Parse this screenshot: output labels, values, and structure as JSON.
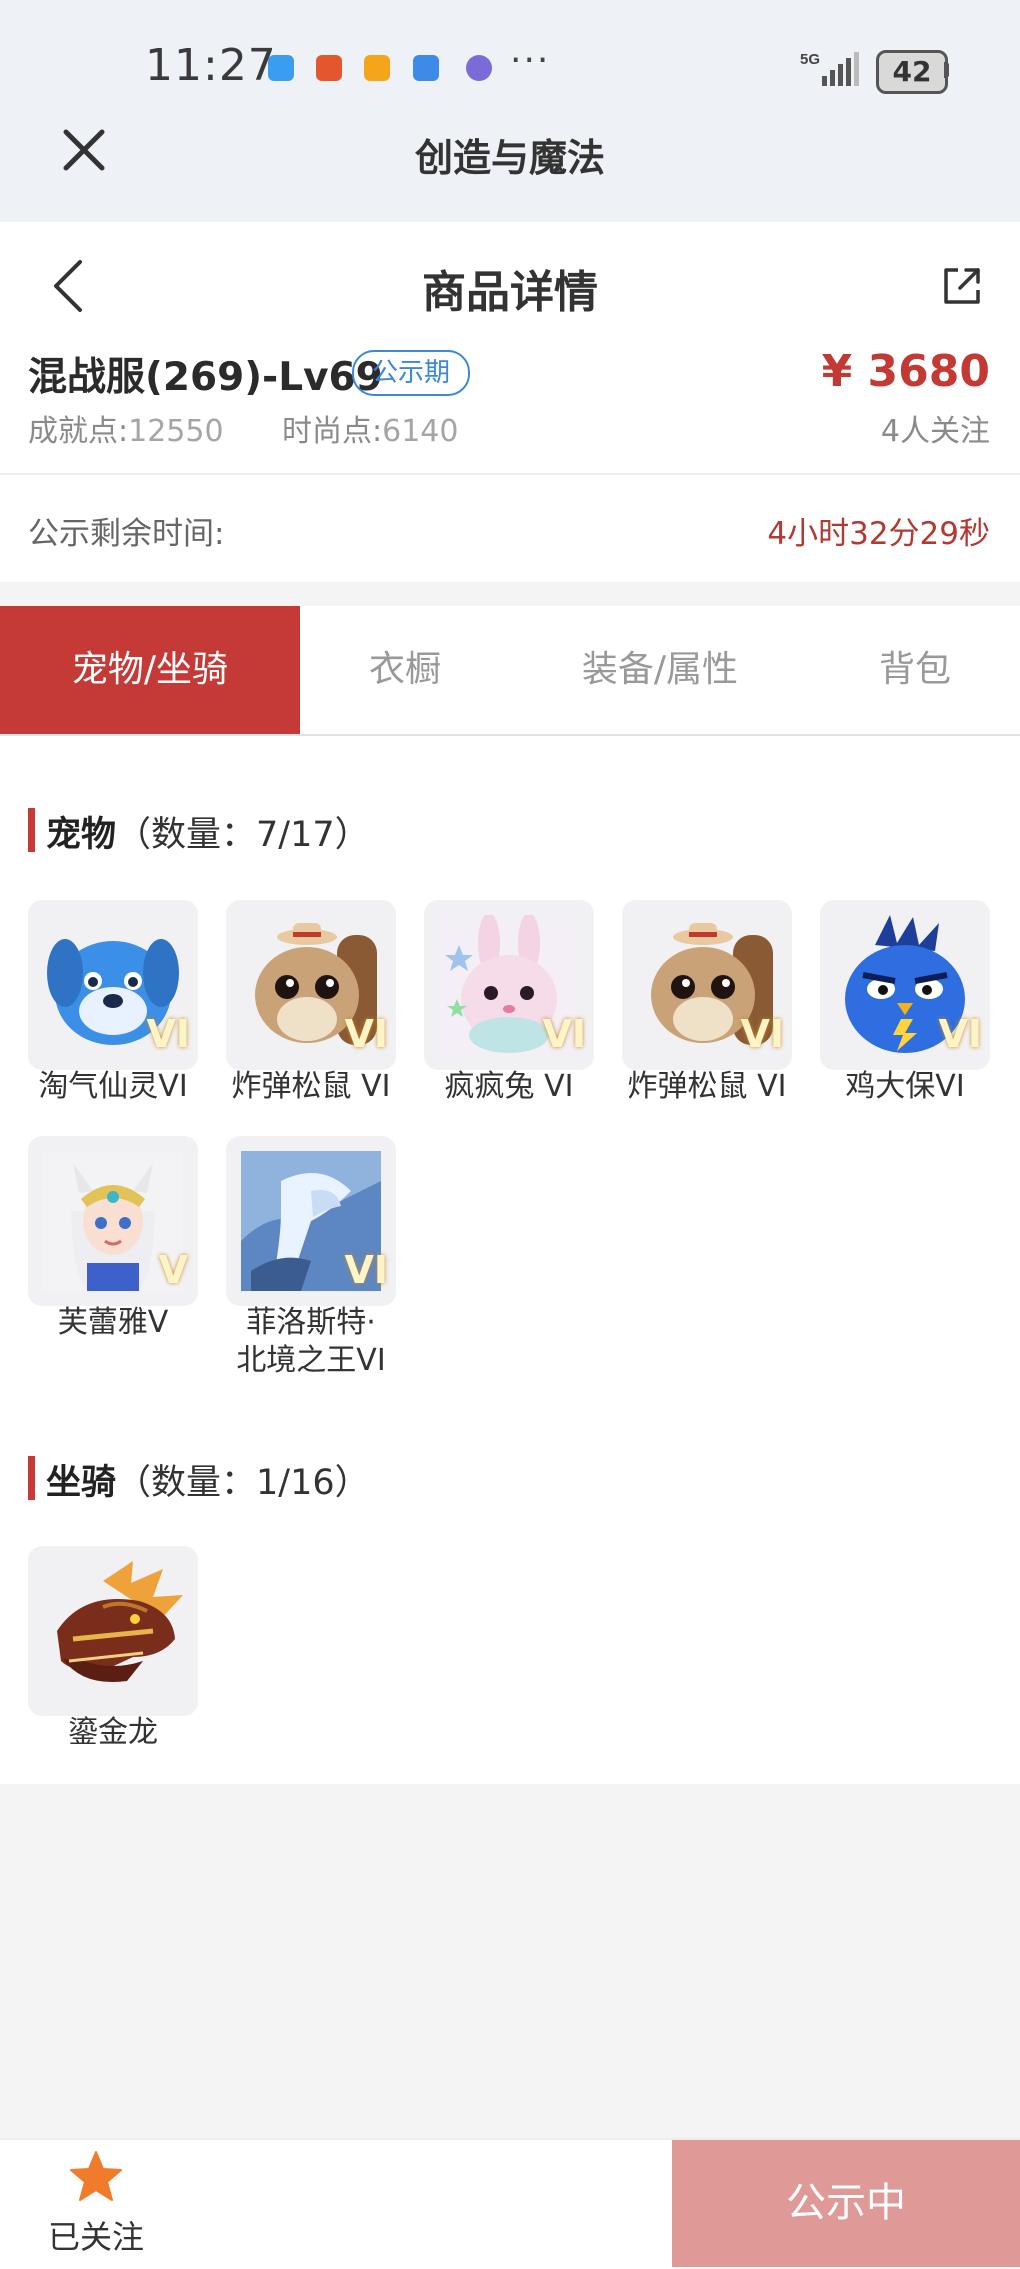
{
  "status_bar": {
    "time": "11:27",
    "network": "5G",
    "battery": "42"
  },
  "app_bar": {
    "title": "创造与魔法"
  },
  "header": {
    "title": "商品详情"
  },
  "item": {
    "title": "混战服(269)-Lv69",
    "badge": "公示期",
    "price": "¥ 3680",
    "achievement_label": "成就点:",
    "achievement_value": "12550",
    "fashion_label": "时尚点:",
    "fashion_value": "6140",
    "followers": "4人关注"
  },
  "remaining": {
    "label": "公示剩余时间:",
    "value": "4小时32分29秒"
  },
  "tabs": [
    {
      "label": "宠物/坐骑",
      "active": true
    },
    {
      "label": "衣橱",
      "active": false
    },
    {
      "label": "装备/属性",
      "active": false
    },
    {
      "label": "背包",
      "active": false
    }
  ],
  "pets": {
    "title": "宠物",
    "count": "（数量：7/17）",
    "items": [
      {
        "name": "淘气仙灵VI",
        "badge": "VI",
        "icon": "blue-dog-pet"
      },
      {
        "name": "炸弹松鼠 VI",
        "badge": "VI",
        "icon": "squirrel-pet"
      },
      {
        "name": "疯疯兔 VI",
        "badge": "VI",
        "icon": "rabbit-pet"
      },
      {
        "name": "炸弹松鼠 VI",
        "badge": "VI",
        "icon": "squirrel-pet"
      },
      {
        "name": "鸡大保VI",
        "badge": "VI",
        "icon": "blue-bird-pet"
      },
      {
        "name": "芙蕾雅V",
        "badge": "V",
        "icon": "valkyrie-pet"
      },
      {
        "name": "菲洛斯特·\n北境之王VI",
        "badge": "VI",
        "icon": "ice-dragon-pet"
      }
    ]
  },
  "mounts": {
    "title": "坐骑",
    "count": "（数量：1/16）",
    "items": [
      {
        "name": "鎏金龙",
        "icon": "golden-dragon-mount"
      }
    ]
  },
  "bottom": {
    "follow_label": "已关注",
    "status_label": "公示中"
  },
  "colors": {
    "accent": "#c53a36",
    "badge_blue": "#3a88d8",
    "disabled_button": "#df9a98"
  }
}
